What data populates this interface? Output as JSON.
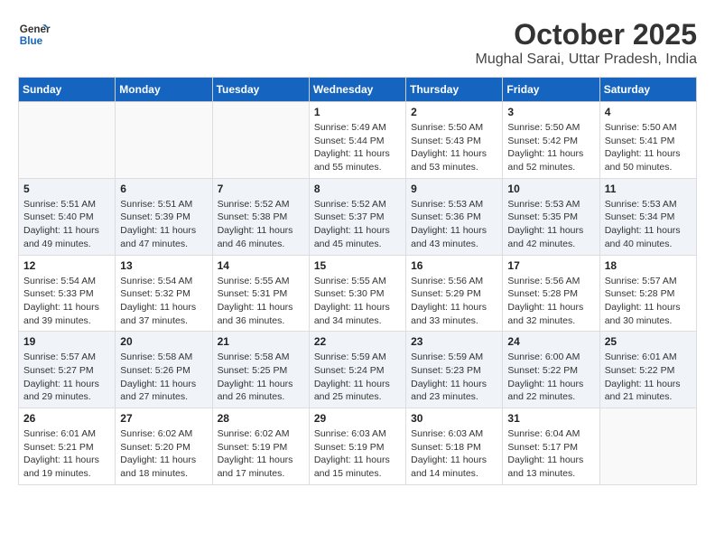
{
  "header": {
    "logo_line1": "General",
    "logo_line2": "Blue",
    "month": "October 2025",
    "location": "Mughal Sarai, Uttar Pradesh, India"
  },
  "weekdays": [
    "Sunday",
    "Monday",
    "Tuesday",
    "Wednesday",
    "Thursday",
    "Friday",
    "Saturday"
  ],
  "rows": [
    [
      {
        "day": "",
        "info": ""
      },
      {
        "day": "",
        "info": ""
      },
      {
        "day": "",
        "info": ""
      },
      {
        "day": "1",
        "info": "Sunrise: 5:49 AM\nSunset: 5:44 PM\nDaylight: 11 hours\nand 55 minutes."
      },
      {
        "day": "2",
        "info": "Sunrise: 5:50 AM\nSunset: 5:43 PM\nDaylight: 11 hours\nand 53 minutes."
      },
      {
        "day": "3",
        "info": "Sunrise: 5:50 AM\nSunset: 5:42 PM\nDaylight: 11 hours\nand 52 minutes."
      },
      {
        "day": "4",
        "info": "Sunrise: 5:50 AM\nSunset: 5:41 PM\nDaylight: 11 hours\nand 50 minutes."
      }
    ],
    [
      {
        "day": "5",
        "info": "Sunrise: 5:51 AM\nSunset: 5:40 PM\nDaylight: 11 hours\nand 49 minutes."
      },
      {
        "day": "6",
        "info": "Sunrise: 5:51 AM\nSunset: 5:39 PM\nDaylight: 11 hours\nand 47 minutes."
      },
      {
        "day": "7",
        "info": "Sunrise: 5:52 AM\nSunset: 5:38 PM\nDaylight: 11 hours\nand 46 minutes."
      },
      {
        "day": "8",
        "info": "Sunrise: 5:52 AM\nSunset: 5:37 PM\nDaylight: 11 hours\nand 45 minutes."
      },
      {
        "day": "9",
        "info": "Sunrise: 5:53 AM\nSunset: 5:36 PM\nDaylight: 11 hours\nand 43 minutes."
      },
      {
        "day": "10",
        "info": "Sunrise: 5:53 AM\nSunset: 5:35 PM\nDaylight: 11 hours\nand 42 minutes."
      },
      {
        "day": "11",
        "info": "Sunrise: 5:53 AM\nSunset: 5:34 PM\nDaylight: 11 hours\nand 40 minutes."
      }
    ],
    [
      {
        "day": "12",
        "info": "Sunrise: 5:54 AM\nSunset: 5:33 PM\nDaylight: 11 hours\nand 39 minutes."
      },
      {
        "day": "13",
        "info": "Sunrise: 5:54 AM\nSunset: 5:32 PM\nDaylight: 11 hours\nand 37 minutes."
      },
      {
        "day": "14",
        "info": "Sunrise: 5:55 AM\nSunset: 5:31 PM\nDaylight: 11 hours\nand 36 minutes."
      },
      {
        "day": "15",
        "info": "Sunrise: 5:55 AM\nSunset: 5:30 PM\nDaylight: 11 hours\nand 34 minutes."
      },
      {
        "day": "16",
        "info": "Sunrise: 5:56 AM\nSunset: 5:29 PM\nDaylight: 11 hours\nand 33 minutes."
      },
      {
        "day": "17",
        "info": "Sunrise: 5:56 AM\nSunset: 5:28 PM\nDaylight: 11 hours\nand 32 minutes."
      },
      {
        "day": "18",
        "info": "Sunrise: 5:57 AM\nSunset: 5:28 PM\nDaylight: 11 hours\nand 30 minutes."
      }
    ],
    [
      {
        "day": "19",
        "info": "Sunrise: 5:57 AM\nSunset: 5:27 PM\nDaylight: 11 hours\nand 29 minutes."
      },
      {
        "day": "20",
        "info": "Sunrise: 5:58 AM\nSunset: 5:26 PM\nDaylight: 11 hours\nand 27 minutes."
      },
      {
        "day": "21",
        "info": "Sunrise: 5:58 AM\nSunset: 5:25 PM\nDaylight: 11 hours\nand 26 minutes."
      },
      {
        "day": "22",
        "info": "Sunrise: 5:59 AM\nSunset: 5:24 PM\nDaylight: 11 hours\nand 25 minutes."
      },
      {
        "day": "23",
        "info": "Sunrise: 5:59 AM\nSunset: 5:23 PM\nDaylight: 11 hours\nand 23 minutes."
      },
      {
        "day": "24",
        "info": "Sunrise: 6:00 AM\nSunset: 5:22 PM\nDaylight: 11 hours\nand 22 minutes."
      },
      {
        "day": "25",
        "info": "Sunrise: 6:01 AM\nSunset: 5:22 PM\nDaylight: 11 hours\nand 21 minutes."
      }
    ],
    [
      {
        "day": "26",
        "info": "Sunrise: 6:01 AM\nSunset: 5:21 PM\nDaylight: 11 hours\nand 19 minutes."
      },
      {
        "day": "27",
        "info": "Sunrise: 6:02 AM\nSunset: 5:20 PM\nDaylight: 11 hours\nand 18 minutes."
      },
      {
        "day": "28",
        "info": "Sunrise: 6:02 AM\nSunset: 5:19 PM\nDaylight: 11 hours\nand 17 minutes."
      },
      {
        "day": "29",
        "info": "Sunrise: 6:03 AM\nSunset: 5:19 PM\nDaylight: 11 hours\nand 15 minutes."
      },
      {
        "day": "30",
        "info": "Sunrise: 6:03 AM\nSunset: 5:18 PM\nDaylight: 11 hours\nand 14 minutes."
      },
      {
        "day": "31",
        "info": "Sunrise: 6:04 AM\nSunset: 5:17 PM\nDaylight: 11 hours\nand 13 minutes."
      },
      {
        "day": "",
        "info": ""
      }
    ]
  ]
}
